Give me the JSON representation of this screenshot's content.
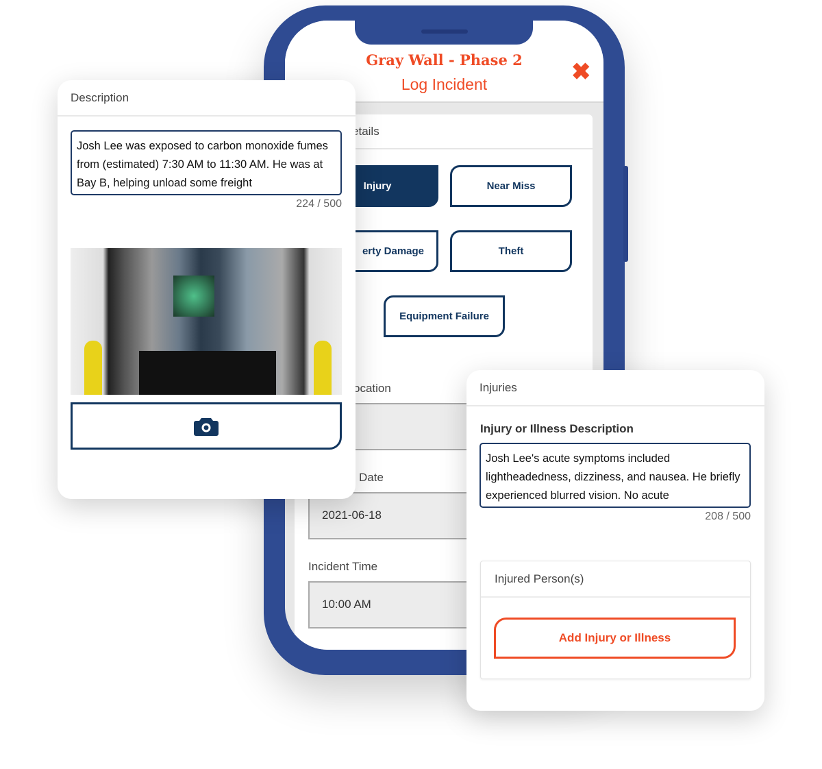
{
  "colors": {
    "brand_orange": "#ef4b25",
    "navy": "#12365f",
    "phone_blue": "#2f4b92"
  },
  "phone": {
    "project_title": "Gray Wall - Phase 2",
    "screen_title": "Log Incident",
    "close_icon": "close-x-icon",
    "section_title": "Report Details",
    "incident_types": [
      {
        "label": "Injury",
        "selected": true
      },
      {
        "label": "Near Miss",
        "selected": false
      },
      {
        "label": "erty Damage",
        "selected": false
      },
      {
        "label": "Theft",
        "selected": false
      },
      {
        "label": "Equipment Failure",
        "selected": false
      }
    ],
    "location_label": "ocation",
    "location_value": "",
    "date_label": "Date",
    "date_value": "2021-06-18",
    "time_label": "Incident Time",
    "time_value": "10:00 AM"
  },
  "description_card": {
    "title": "Description",
    "text": "Josh Lee was exposed to carbon monoxide fumes from (estimated) 7:30 AM to 11:30 AM. He was at Bay B, helping unload some freight",
    "counter": "224 / 500",
    "camera_icon": "camera-icon"
  },
  "injuries_card": {
    "title": "Injuries",
    "field_label": "Injury or Illness Description",
    "text": "Josh Lee's acute symptoms included lightheadedness, dizziness, and nausea. He briefly experienced blurred vision. No acute",
    "counter": "208 / 500",
    "persons_title": "Injured Person(s)",
    "add_button": "Add Injury or Illness"
  }
}
